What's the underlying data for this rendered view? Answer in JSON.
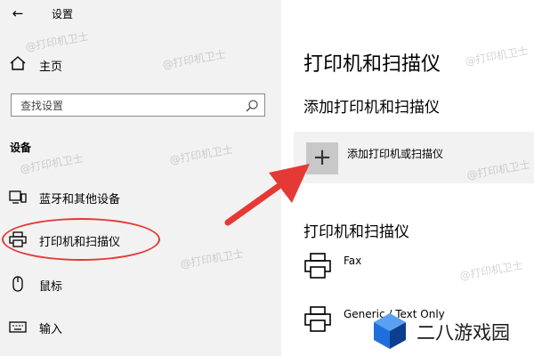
{
  "window": {
    "title": "设置"
  },
  "sidebar": {
    "home_label": "主页",
    "search_placeholder": "查找设置",
    "section_title": "设备",
    "items": [
      {
        "label": "蓝牙和其他设备",
        "icon": "bluetooth-devices-icon"
      },
      {
        "label": "打印机和扫描仪",
        "icon": "printer-icon",
        "highlighted": true
      },
      {
        "label": "鼠标",
        "icon": "mouse-icon"
      },
      {
        "label": "输入",
        "icon": "keyboard-icon"
      }
    ]
  },
  "main": {
    "title": "打印机和扫描仪",
    "add_section_title": "添加打印机和扫描仪",
    "add_button_label": "添加打印机或扫描仪",
    "list_title": "打印机和扫描仪",
    "printers": [
      {
        "name": "Fax"
      },
      {
        "name": "Generic / Text Only"
      }
    ]
  },
  "watermark": {
    "text": "@打印机卫士"
  },
  "logo": {
    "text": "二八游戏园"
  },
  "colors": {
    "annotation": "#e53935",
    "sidebar_bg": "#f2f2f2",
    "logo_blue": "#1e6fd9"
  }
}
